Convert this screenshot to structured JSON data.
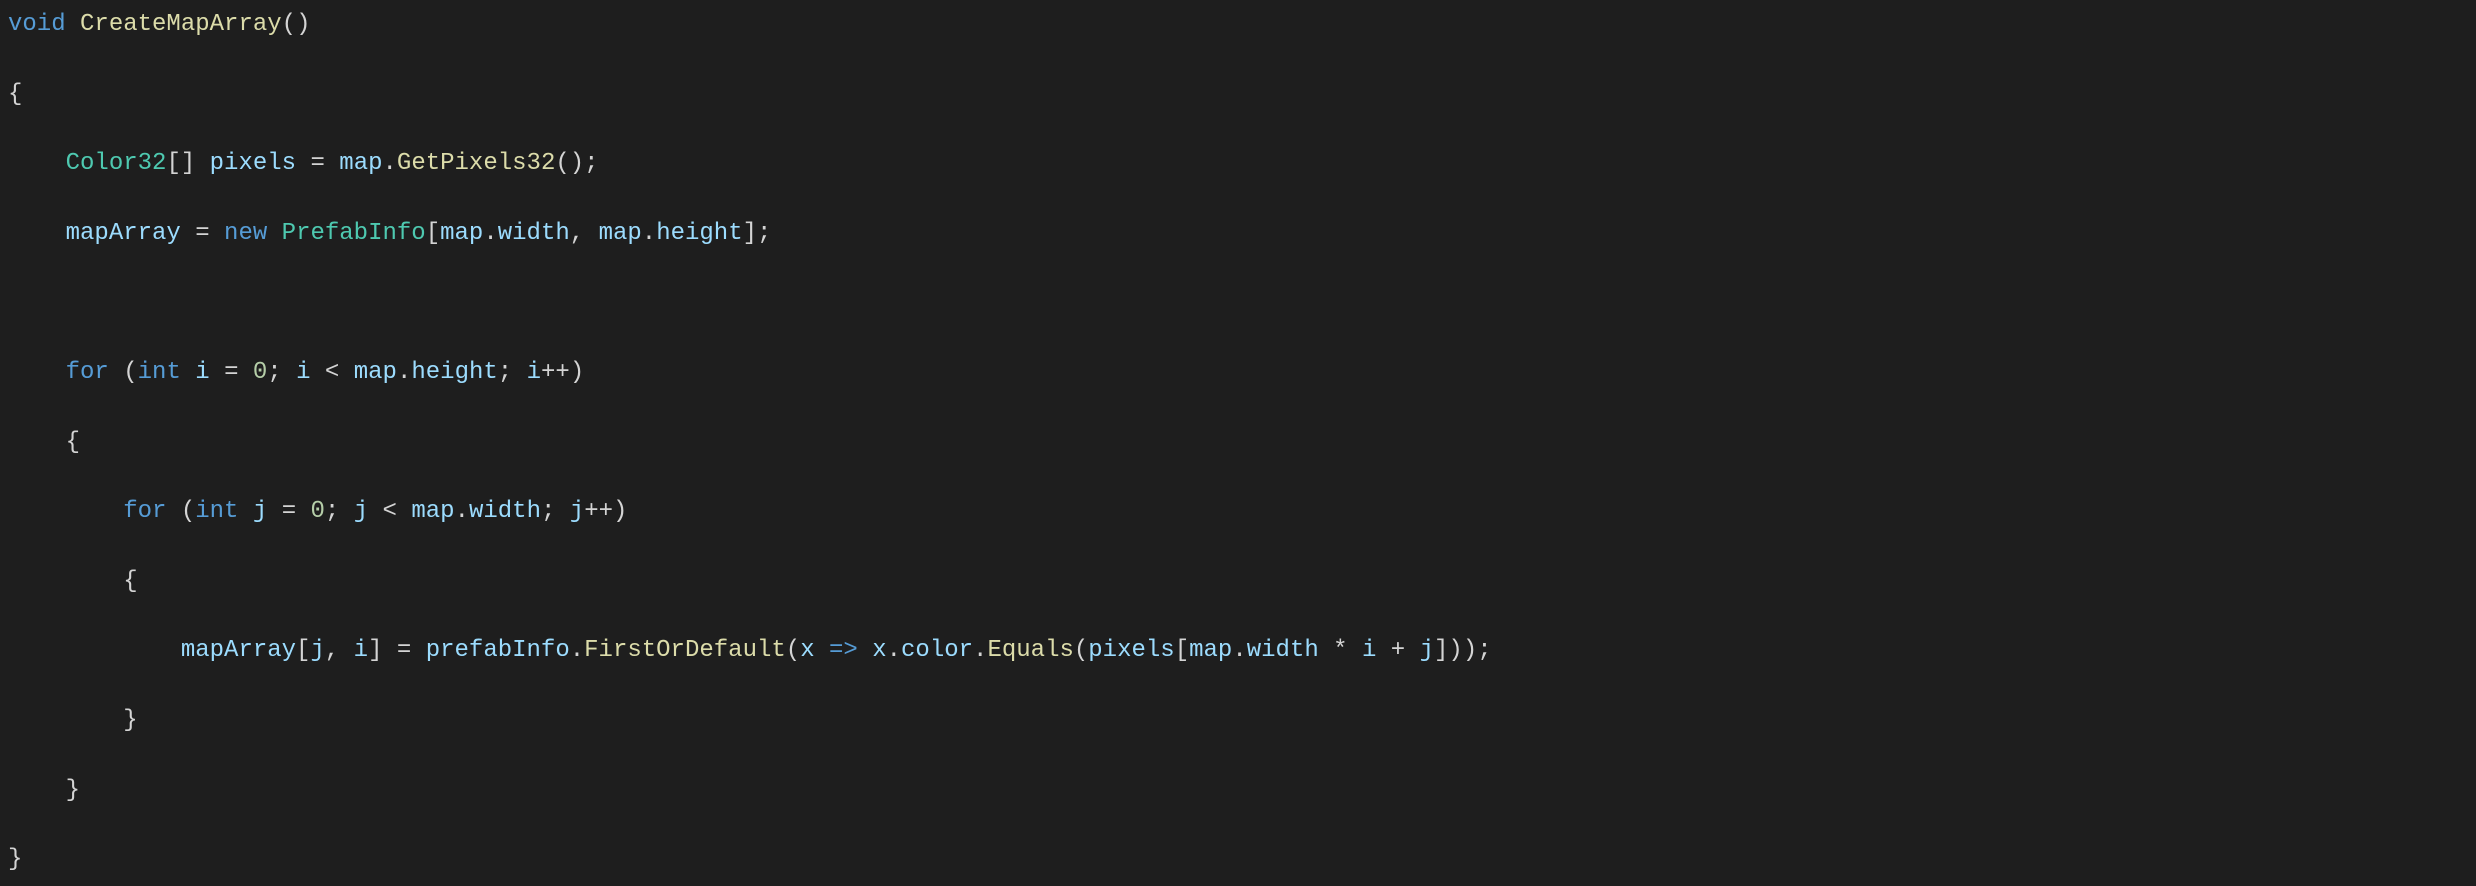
{
  "tokens": {
    "kw_void": "void",
    "kw_new": "new",
    "kw_for": "for",
    "kw_int": "int",
    "fn_CreateMapArray": "CreateMapArray",
    "fn_GetPixels32": "GetPixels32",
    "fn_FirstOrDefault": "FirstOrDefault",
    "fn_Equals": "Equals",
    "ty_Color32": "Color32",
    "ty_PrefabInfo": "PrefabInfo",
    "id_pixels": "pixels",
    "id_map": "map",
    "id_mapArray": "mapArray",
    "id_width": "width",
    "id_height": "height",
    "id_i": "i",
    "id_j": "j",
    "id_prefabInfo": "prefabInfo",
    "id_x": "x",
    "id_color": "color",
    "num_0": "0",
    "p_open_paren": "(",
    "p_close_paren": ")",
    "p_open_brace": "{",
    "p_close_brace": "}",
    "p_open_bracket": "[",
    "p_close_bracket": "]",
    "p_brackets": "[]",
    "p_semi": ";",
    "p_comma": ",",
    "p_eq": "=",
    "p_lt": "<",
    "p_pp": "++",
    "p_dot": ".",
    "p_arrow": "=>",
    "p_star": "*",
    "p_plus": "+",
    "sp": " "
  },
  "chart_data": null
}
